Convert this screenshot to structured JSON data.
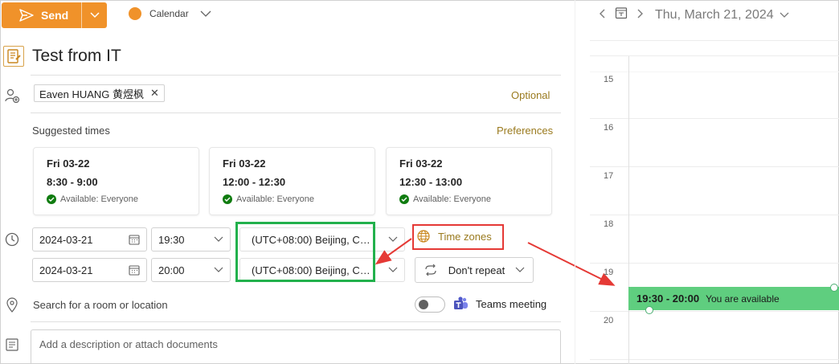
{
  "toolbar": {
    "send_label": "Send",
    "calendar_label": "Calendar",
    "accent_color": "#f0922a"
  },
  "event": {
    "title": "Test from IT",
    "attendee_chip": "Eaven HUANG 黄煜枫",
    "optional_label": "Optional"
  },
  "suggestions": {
    "heading": "Suggested times",
    "preferences_label": "Preferences",
    "cards": [
      {
        "date": "Fri 03-22",
        "time": "8:30 - 9:00",
        "availability": "Available: Everyone"
      },
      {
        "date": "Fri 03-22",
        "time": "12:00 - 12:30",
        "availability": "Available: Everyone"
      },
      {
        "date": "Fri 03-22",
        "time": "12:30 - 13:00",
        "availability": "Available: Everyone"
      }
    ]
  },
  "schedule": {
    "start_date": "2024-03-21",
    "start_time": "19:30",
    "start_timezone": "(UTC+08:00) Beijing, Ch...",
    "end_date": "2024-03-21",
    "end_time": "20:00",
    "end_timezone": "(UTC+08:00) Beijing, Ch...",
    "time_zones_label": "Time zones",
    "repeat_label": "Don't repeat"
  },
  "location": {
    "placeholder": "Search for a room or location",
    "teams_label": "Teams meeting",
    "teams_enabled": false
  },
  "description": {
    "placeholder": "Add a description or attach documents"
  },
  "calendar": {
    "date_label": "Thu, March 21, 2024",
    "hours": [
      "15",
      "16",
      "17",
      "18",
      "19",
      "20"
    ],
    "event_time": "19:30 - 20:00",
    "event_status": "You are available",
    "event_color": "#5fce7f"
  },
  "annotations": {
    "green_highlight": "#22b14c",
    "red_highlight": "#e53935"
  }
}
